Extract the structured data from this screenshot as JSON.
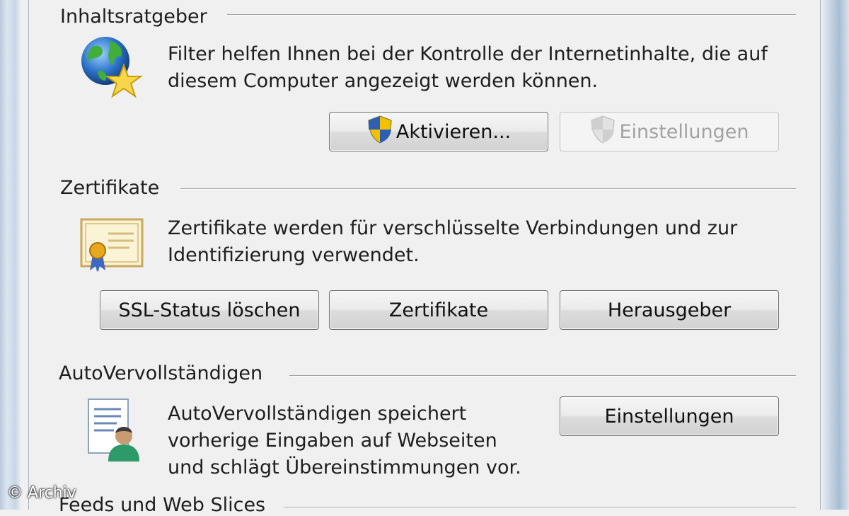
{
  "content_advisor": {
    "title": "Inhaltsratgeber",
    "description": "Filter helfen Ihnen bei der Kontrolle der Internetinhalte, die auf\ndiesem Computer angezeigt werden können.",
    "icon": "globe-star-icon",
    "enable_button": "Aktivieren...",
    "settings_button": "Einstellungen"
  },
  "certificates": {
    "title": "Zertifikate",
    "description": "Zertifikate werden für verschlüsselte Verbindungen und zur\nIdentifizierung verwendet.",
    "icon": "certificate-icon",
    "clear_ssl_button": "SSL-Status löschen",
    "certificates_button": "Zertifikate",
    "publishers_button": "Herausgeber"
  },
  "autocomplete": {
    "title": "AutoVervollständigen",
    "description": "AutoVervollständigen speichert\nvorherige Eingaben auf Webseiten\nund schlägt Übereinstimmungen vor.",
    "icon": "autocomplete-form-user-icon",
    "settings_button": "Einstellungen"
  },
  "feeds": {
    "title": "Feeds und Web Slices"
  },
  "watermark": "© Archiv",
  "colors": {
    "background": "#f0f0f0",
    "button_border": "#707070",
    "disabled_text": "#a2a2a2",
    "shield_blue": "#2f5fb3",
    "shield_yellow": "#f2c200"
  }
}
